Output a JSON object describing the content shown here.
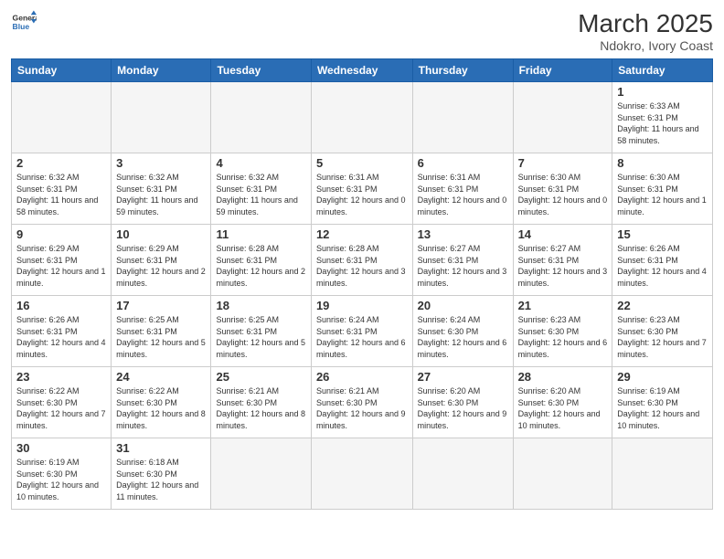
{
  "header": {
    "logo_general": "General",
    "logo_blue": "Blue",
    "month_year": "March 2025",
    "location": "Ndokro, Ivory Coast"
  },
  "weekdays": [
    "Sunday",
    "Monday",
    "Tuesday",
    "Wednesday",
    "Thursday",
    "Friday",
    "Saturday"
  ],
  "days": {
    "1": {
      "sunrise": "6:33 AM",
      "sunset": "6:31 PM",
      "daylight": "11 hours and 58 minutes."
    },
    "2": {
      "sunrise": "6:32 AM",
      "sunset": "6:31 PM",
      "daylight": "11 hours and 58 minutes."
    },
    "3": {
      "sunrise": "6:32 AM",
      "sunset": "6:31 PM",
      "daylight": "11 hours and 59 minutes."
    },
    "4": {
      "sunrise": "6:32 AM",
      "sunset": "6:31 PM",
      "daylight": "11 hours and 59 minutes."
    },
    "5": {
      "sunrise": "6:31 AM",
      "sunset": "6:31 PM",
      "daylight": "12 hours and 0 minutes."
    },
    "6": {
      "sunrise": "6:31 AM",
      "sunset": "6:31 PM",
      "daylight": "12 hours and 0 minutes."
    },
    "7": {
      "sunrise": "6:30 AM",
      "sunset": "6:31 PM",
      "daylight": "12 hours and 0 minutes."
    },
    "8": {
      "sunrise": "6:30 AM",
      "sunset": "6:31 PM",
      "daylight": "12 hours and 1 minute."
    },
    "9": {
      "sunrise": "6:29 AM",
      "sunset": "6:31 PM",
      "daylight": "12 hours and 1 minute."
    },
    "10": {
      "sunrise": "6:29 AM",
      "sunset": "6:31 PM",
      "daylight": "12 hours and 2 minutes."
    },
    "11": {
      "sunrise": "6:28 AM",
      "sunset": "6:31 PM",
      "daylight": "12 hours and 2 minutes."
    },
    "12": {
      "sunrise": "6:28 AM",
      "sunset": "6:31 PM",
      "daylight": "12 hours and 3 minutes."
    },
    "13": {
      "sunrise": "6:27 AM",
      "sunset": "6:31 PM",
      "daylight": "12 hours and 3 minutes."
    },
    "14": {
      "sunrise": "6:27 AM",
      "sunset": "6:31 PM",
      "daylight": "12 hours and 3 minutes."
    },
    "15": {
      "sunrise": "6:26 AM",
      "sunset": "6:31 PM",
      "daylight": "12 hours and 4 minutes."
    },
    "16": {
      "sunrise": "6:26 AM",
      "sunset": "6:31 PM",
      "daylight": "12 hours and 4 minutes."
    },
    "17": {
      "sunrise": "6:25 AM",
      "sunset": "6:31 PM",
      "daylight": "12 hours and 5 minutes."
    },
    "18": {
      "sunrise": "6:25 AM",
      "sunset": "6:31 PM",
      "daylight": "12 hours and 5 minutes."
    },
    "19": {
      "sunrise": "6:24 AM",
      "sunset": "6:31 PM",
      "daylight": "12 hours and 6 minutes."
    },
    "20": {
      "sunrise": "6:24 AM",
      "sunset": "6:30 PM",
      "daylight": "12 hours and 6 minutes."
    },
    "21": {
      "sunrise": "6:23 AM",
      "sunset": "6:30 PM",
      "daylight": "12 hours and 6 minutes."
    },
    "22": {
      "sunrise": "6:23 AM",
      "sunset": "6:30 PM",
      "daylight": "12 hours and 7 minutes."
    },
    "23": {
      "sunrise": "6:22 AM",
      "sunset": "6:30 PM",
      "daylight": "12 hours and 7 minutes."
    },
    "24": {
      "sunrise": "6:22 AM",
      "sunset": "6:30 PM",
      "daylight": "12 hours and 8 minutes."
    },
    "25": {
      "sunrise": "6:21 AM",
      "sunset": "6:30 PM",
      "daylight": "12 hours and 8 minutes."
    },
    "26": {
      "sunrise": "6:21 AM",
      "sunset": "6:30 PM",
      "daylight": "12 hours and 9 minutes."
    },
    "27": {
      "sunrise": "6:20 AM",
      "sunset": "6:30 PM",
      "daylight": "12 hours and 9 minutes."
    },
    "28": {
      "sunrise": "6:20 AM",
      "sunset": "6:30 PM",
      "daylight": "12 hours and 10 minutes."
    },
    "29": {
      "sunrise": "6:19 AM",
      "sunset": "6:30 PM",
      "daylight": "12 hours and 10 minutes."
    },
    "30": {
      "sunrise": "6:19 AM",
      "sunset": "6:30 PM",
      "daylight": "12 hours and 10 minutes."
    },
    "31": {
      "sunrise": "6:18 AM",
      "sunset": "6:30 PM",
      "daylight": "12 hours and 11 minutes."
    }
  }
}
